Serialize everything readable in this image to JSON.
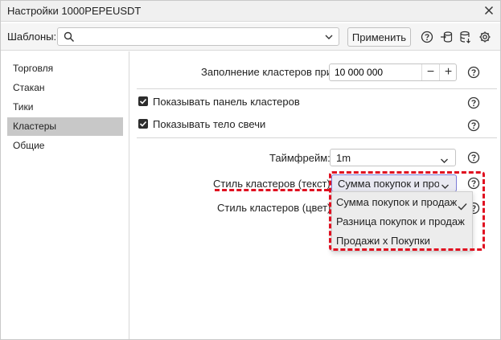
{
  "window": {
    "title": "Настройки 1000PEPEUSDT"
  },
  "templates": {
    "label": "Шаблоны:",
    "search_value": "",
    "apply_label": "Применить"
  },
  "sidebar": {
    "items": [
      {
        "label": "Торговля",
        "active": false
      },
      {
        "label": "Стакан",
        "active": false
      },
      {
        "label": "Тики",
        "active": false
      },
      {
        "label": "Кластеры",
        "active": true
      },
      {
        "label": "Общие",
        "active": false
      }
    ]
  },
  "settings": {
    "fill_label": "Заполнение кластеров при:",
    "fill_value": "10 000 000",
    "show_panel_label": "Показывать панель кластеров",
    "show_panel_checked": true,
    "show_body_label": "Показывать тело свечи",
    "show_body_checked": true,
    "timeframe_label": "Таймфрейм:",
    "timeframe_value": "1m",
    "text_style_label": "Стиль кластеров (текст):",
    "text_style_value": "Сумма покупок и продаж",
    "color_style_label": "Стиль кластеров (цвет):"
  },
  "dropdown": {
    "options": [
      {
        "label": "Сумма покупок и продаж",
        "selected": true
      },
      {
        "label": "Разница покупок и продаж",
        "selected": false
      },
      {
        "label": "Продажи x Покупки",
        "selected": false
      }
    ]
  },
  "colors": {
    "annotation_red": "#e01020",
    "active_nav": "#c8c8c8"
  }
}
